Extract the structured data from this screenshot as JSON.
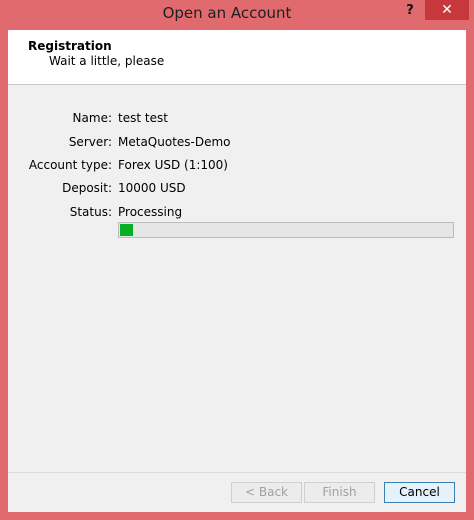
{
  "window": {
    "title": "Open an Account",
    "help_label": "?",
    "close_label": "✕"
  },
  "header": {
    "title": "Registration",
    "subtitle": "Wait a little, please"
  },
  "fields": [
    {
      "label": "Name:",
      "value": "test test"
    },
    {
      "label": "Server:",
      "value": "MetaQuotes-Demo"
    },
    {
      "label": "Account type:",
      "value": "Forex USD (1:100)"
    },
    {
      "label": "Deposit:",
      "value": "10000 USD"
    },
    {
      "label": "Status:",
      "value": "Processing"
    }
  ],
  "progress": {
    "fraction": 0.04,
    "color": "#06b025"
  },
  "buttons": {
    "back": "< Back",
    "finish": "Finish",
    "cancel": "Cancel"
  }
}
